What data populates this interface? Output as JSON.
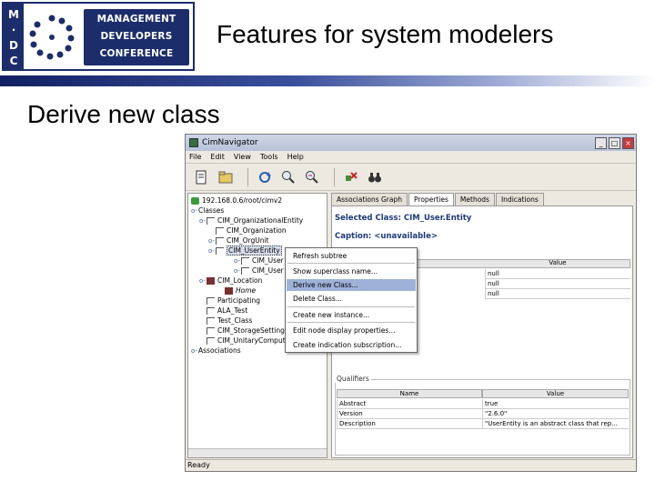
{
  "logo": {
    "letters": [
      "M",
      "D",
      "C"
    ],
    "lines": [
      "MANAGEMENT",
      "DEVELOPERS",
      "CONFERENCE"
    ]
  },
  "slide": {
    "title": "Features for system modelers",
    "subtitle": "Derive new class"
  },
  "window": {
    "title": "CimNavigator",
    "menu": [
      "File",
      "Edit",
      "View",
      "Tools",
      "Help"
    ],
    "status": "Ready"
  },
  "tree": {
    "items": [
      {
        "label": "192.168.0.6/root/cimv2",
        "icon": "host-icon"
      },
      {
        "label": "Classes",
        "icon": "folder-icon"
      },
      {
        "label": "CIM_OrganizationalEntity",
        "icon": "class-icon"
      },
      {
        "label": "CIM_Organization",
        "icon": "class-icon"
      },
      {
        "label": "CIM_OrgUnit",
        "icon": "class-icon"
      },
      {
        "label": "CIM_UserEntity",
        "icon": "class-icon"
      },
      {
        "label": "CIM_User",
        "icon": "class-icon"
      },
      {
        "label": "CIM_User",
        "icon": "class-icon"
      },
      {
        "label": "CIM_Location",
        "icon": "folder-icon"
      },
      {
        "label": "Home",
        "icon": "instance-icon"
      },
      {
        "label": "Participating",
        "icon": "class-icon"
      },
      {
        "label": "ALA_Test",
        "icon": "class-icon"
      },
      {
        "label": "Test_Class",
        "icon": "class-icon"
      },
      {
        "label": "CIM_StorageSetting",
        "icon": "class-icon"
      },
      {
        "label": "CIM_UnitaryComputer",
        "icon": "class-icon"
      },
      {
        "label": "Associations",
        "icon": "folder-icon"
      }
    ]
  },
  "tabs": [
    "Associations Graph",
    "Properties",
    "Methods",
    "Indications"
  ],
  "properties": {
    "selected_class_label": "Selected Class:",
    "selected_class": "CIM_User.Entity",
    "caption_label": "Caption:",
    "caption_value": "<unavailable>",
    "value_header": "Value",
    "values": [
      "null",
      "null",
      "null"
    ]
  },
  "qualifiers": {
    "legend": "Qualifiers",
    "headers": [
      "Name",
      "Value"
    ],
    "rows": [
      {
        "name": "Abstract",
        "value": "true"
      },
      {
        "name": "Version",
        "value": "\"2.6.0\""
      },
      {
        "name": "Description",
        "value": "\"UserEntity is an abstract class that rep..."
      }
    ]
  },
  "context_menu": {
    "items": [
      "Refresh subtree",
      "Show superclass name...",
      "Derive new Class...",
      "Delete Class...",
      "Create new instance...",
      "Edit node display properties...",
      "Create indication subscription..."
    ],
    "highlighted": "Derive new Class..."
  }
}
